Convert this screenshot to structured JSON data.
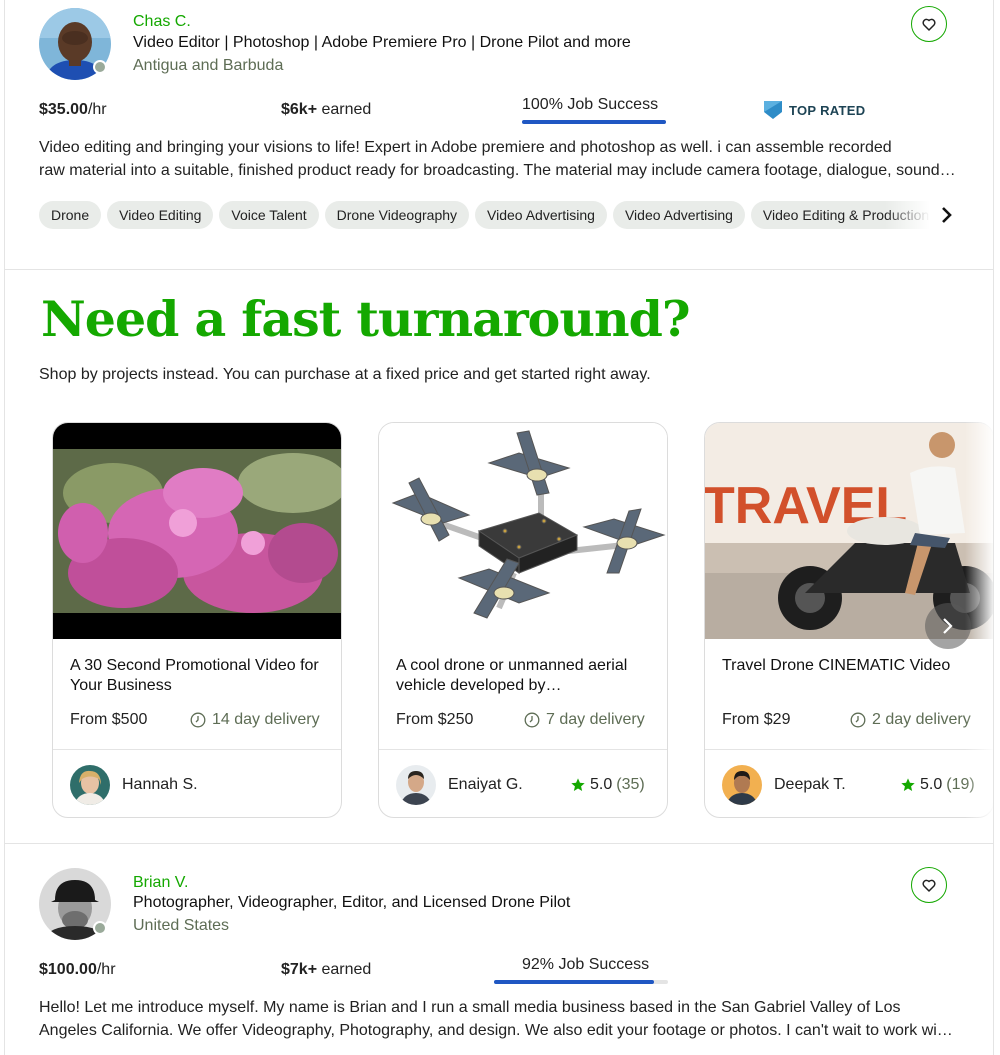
{
  "freelancers": [
    {
      "name": "Chas C.",
      "title": "Video Editor | Photoshop | Adobe Premiere Pro | Drone Pilot and more",
      "country": "Antigua and Barbuda",
      "rate_value": "$35.00",
      "rate_unit": "/hr",
      "earned_value": "$6k+",
      "earned_label": " earned",
      "job_success": "100% Job Success",
      "job_success_fraction": 1.0,
      "badge": "TOP RATED",
      "description_lines": [
        "Video editing and bringing your visions to life! Expert in Adobe premiere and photoshop as well. i can assemble recorded",
        "raw material into a suitable, finished product ready for broadcasting. The material may include camera footage, dialogue, sound effects, graphics and special effects."
      ],
      "skills": [
        "Drone",
        "Video Editing",
        "Voice Talent",
        "Drone Videography",
        "Video Advertising",
        "Video Advertising",
        "Video Editing & Production"
      ]
    },
    {
      "name": "Brian V.",
      "title": "Photographer, Videographer, Editor, and Licensed Drone Pilot",
      "country": "United States",
      "rate_value": "$100.00",
      "rate_unit": "/hr",
      "earned_value": "$7k+",
      "earned_label": " earned",
      "job_success": "92% Job Success",
      "job_success_fraction": 0.92,
      "description_lines": [
        "Hello! Let me introduce myself. My name is Brian and I run a small media business based in the San Gabriel Valley of Los",
        "Angeles California. We offer Videography, Photography, and design. We also edit your footage or photos. I can't wait to work with you!"
      ]
    }
  ],
  "promo": {
    "title": "Need a fast turnaround?",
    "subtitle": "Shop by projects instead. You can purchase at a fixed price and get started right away."
  },
  "projects": [
    {
      "title": "A 30 Second Promotional Video for Your Business",
      "price": "From $500",
      "delivery": "14 day delivery",
      "seller": "Hannah S.",
      "rating": "",
      "rating_count": ""
    },
    {
      "title": "A cool drone or unmanned aerial vehicle developed by…",
      "price": "From $250",
      "delivery": "7 day delivery",
      "seller": "Enaiyat G.",
      "rating": "5.0",
      "rating_count": "(35)"
    },
    {
      "title": "Travel Drone CINEMATIC Video",
      "price": "From $29",
      "delivery": "2 day delivery",
      "seller": "Deepak T.",
      "rating": "5.0",
      "rating_count": "(19)",
      "thumb_text": "TRAVEL"
    }
  ],
  "icons": {
    "favorite": "heart-icon",
    "next": "chevron-right-icon",
    "delivery": "clock-icon",
    "rating": "star-icon",
    "badge": "top-rated-badge-icon"
  },
  "colors": {
    "brand_green": "#14a800",
    "job_success_blue": "#1f57c3",
    "chip_bg": "#e9ece9",
    "muted_text": "#5e6d55"
  }
}
